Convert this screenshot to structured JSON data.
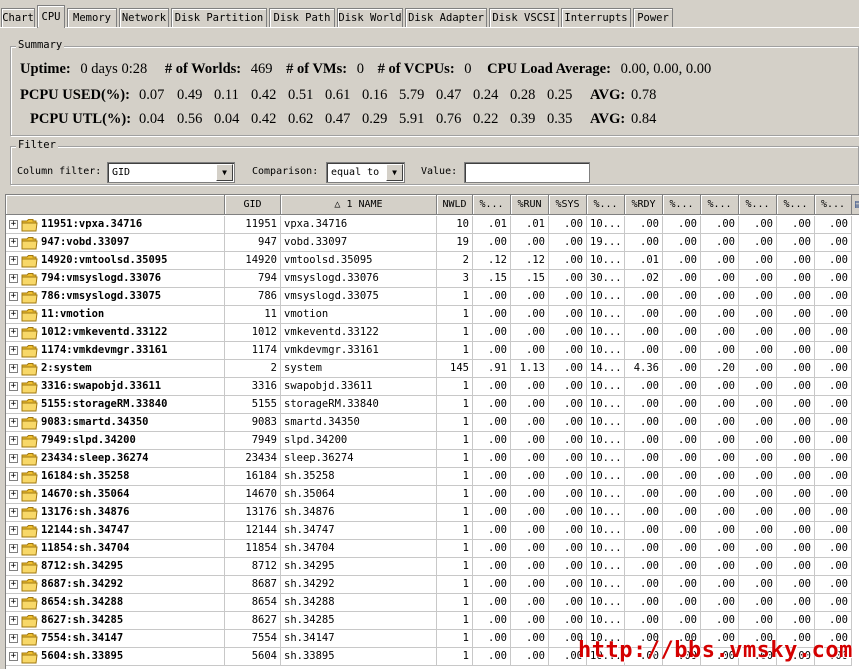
{
  "tabs": [
    "Chart",
    "CPU",
    "Memory",
    "Network",
    "Disk Partition",
    "Disk Path",
    "Disk World",
    "Disk Adapter",
    "Disk VSCSI",
    "Interrupts",
    "Power"
  ],
  "active_tab": "CPU",
  "summary": {
    "legend": "Summary",
    "uptime_label": "Uptime:",
    "uptime_value": "0 days 0:28",
    "worlds_label": "# of Worlds:",
    "worlds_value": "469",
    "vms_label": "# of VMs:",
    "vms_value": "0",
    "vcpus_label": "# of VCPUs:",
    "vcpus_value": "0",
    "load_label": "CPU Load Average:",
    "load_value": "0.00, 0.00, 0.00",
    "pcpu_used_label": "PCPU USED(%):",
    "pcpu_used": [
      "0.07",
      "0.49",
      "0.11",
      "0.42",
      "0.51",
      "0.61",
      "0.16",
      "5.79",
      "0.47",
      "0.24",
      "0.28",
      "0.25"
    ],
    "used_avg_label": "AVG:",
    "used_avg": "0.78",
    "pcpu_utl_label": "PCPU UTL(%):",
    "pcpu_utl": [
      "0.04",
      "0.56",
      "0.04",
      "0.42",
      "0.62",
      "0.47",
      "0.29",
      "5.91",
      "0.76",
      "0.22",
      "0.39",
      "0.35"
    ],
    "utl_avg_label": "AVG:",
    "utl_avg": "0.84"
  },
  "filter": {
    "legend": "Filter",
    "column_label": "Column filter:",
    "column_value": "GID",
    "comparison_label": "Comparison:",
    "comparison_value": "equal to",
    "value_label": "Value:",
    "value_text": ""
  },
  "table": {
    "headers": [
      "",
      "GID",
      "△ 1 NAME",
      "NWLD",
      "%...",
      "%RUN",
      "%SYS",
      "%...",
      "%RDY",
      "%...",
      "%...",
      "%...",
      "%...",
      "%..."
    ],
    "rows": [
      [
        "11951:vpxa.34716",
        "11951",
        "vpxa.34716",
        "10",
        ".01",
        ".01",
        ".00",
        "10...",
        ".00",
        ".00",
        ".00",
        ".00",
        ".00",
        ".00"
      ],
      [
        "947:vobd.33097",
        "947",
        "vobd.33097",
        "19",
        ".00",
        ".00",
        ".00",
        "19...",
        ".00",
        ".00",
        ".00",
        ".00",
        ".00",
        ".00"
      ],
      [
        "14920:vmtoolsd.35095",
        "14920",
        "vmtoolsd.35095",
        "2",
        ".12",
        ".12",
        ".00",
        "10...",
        ".01",
        ".00",
        ".00",
        ".00",
        ".00",
        ".00"
      ],
      [
        "794:vmsyslogd.33076",
        "794",
        "vmsyslogd.33076",
        "3",
        ".15",
        ".15",
        ".00",
        "30...",
        ".02",
        ".00",
        ".00",
        ".00",
        ".00",
        ".00"
      ],
      [
        "786:vmsyslogd.33075",
        "786",
        "vmsyslogd.33075",
        "1",
        ".00",
        ".00",
        ".00",
        "10...",
        ".00",
        ".00",
        ".00",
        ".00",
        ".00",
        ".00"
      ],
      [
        "11:vmotion",
        "11",
        "vmotion",
        "1",
        ".00",
        ".00",
        ".00",
        "10...",
        ".00",
        ".00",
        ".00",
        ".00",
        ".00",
        ".00"
      ],
      [
        "1012:vmkeventd.33122",
        "1012",
        "vmkeventd.33122",
        "1",
        ".00",
        ".00",
        ".00",
        "10...",
        ".00",
        ".00",
        ".00",
        ".00",
        ".00",
        ".00"
      ],
      [
        "1174:vmkdevmgr.33161",
        "1174",
        "vmkdevmgr.33161",
        "1",
        ".00",
        ".00",
        ".00",
        "10...",
        ".00",
        ".00",
        ".00",
        ".00",
        ".00",
        ".00"
      ],
      [
        "2:system",
        "2",
        "system",
        "145",
        ".91",
        "1.13",
        ".00",
        "14...",
        "4.36",
        ".00",
        ".20",
        ".00",
        ".00",
        ".00"
      ],
      [
        "3316:swapobjd.33611",
        "3316",
        "swapobjd.33611",
        "1",
        ".00",
        ".00",
        ".00",
        "10...",
        ".00",
        ".00",
        ".00",
        ".00",
        ".00",
        ".00"
      ],
      [
        "5155:storageRM.33840",
        "5155",
        "storageRM.33840",
        "1",
        ".00",
        ".00",
        ".00",
        "10...",
        ".00",
        ".00",
        ".00",
        ".00",
        ".00",
        ".00"
      ],
      [
        "9083:smartd.34350",
        "9083",
        "smartd.34350",
        "1",
        ".00",
        ".00",
        ".00",
        "10...",
        ".00",
        ".00",
        ".00",
        ".00",
        ".00",
        ".00"
      ],
      [
        "7949:slpd.34200",
        "7949",
        "slpd.34200",
        "1",
        ".00",
        ".00",
        ".00",
        "10...",
        ".00",
        ".00",
        ".00",
        ".00",
        ".00",
        ".00"
      ],
      [
        "23434:sleep.36274",
        "23434",
        "sleep.36274",
        "1",
        ".00",
        ".00",
        ".00",
        "10...",
        ".00",
        ".00",
        ".00",
        ".00",
        ".00",
        ".00"
      ],
      [
        "16184:sh.35258",
        "16184",
        "sh.35258",
        "1",
        ".00",
        ".00",
        ".00",
        "10...",
        ".00",
        ".00",
        ".00",
        ".00",
        ".00",
        ".00"
      ],
      [
        "14670:sh.35064",
        "14670",
        "sh.35064",
        "1",
        ".00",
        ".00",
        ".00",
        "10...",
        ".00",
        ".00",
        ".00",
        ".00",
        ".00",
        ".00"
      ],
      [
        "13176:sh.34876",
        "13176",
        "sh.34876",
        "1",
        ".00",
        ".00",
        ".00",
        "10...",
        ".00",
        ".00",
        ".00",
        ".00",
        ".00",
        ".00"
      ],
      [
        "12144:sh.34747",
        "12144",
        "sh.34747",
        "1",
        ".00",
        ".00",
        ".00",
        "10...",
        ".00",
        ".00",
        ".00",
        ".00",
        ".00",
        ".00"
      ],
      [
        "11854:sh.34704",
        "11854",
        "sh.34704",
        "1",
        ".00",
        ".00",
        ".00",
        "10...",
        ".00",
        ".00",
        ".00",
        ".00",
        ".00",
        ".00"
      ],
      [
        "8712:sh.34295",
        "8712",
        "sh.34295",
        "1",
        ".00",
        ".00",
        ".00",
        "10...",
        ".00",
        ".00",
        ".00",
        ".00",
        ".00",
        ".00"
      ],
      [
        "8687:sh.34292",
        "8687",
        "sh.34292",
        "1",
        ".00",
        ".00",
        ".00",
        "10...",
        ".00",
        ".00",
        ".00",
        ".00",
        ".00",
        ".00"
      ],
      [
        "8654:sh.34288",
        "8654",
        "sh.34288",
        "1",
        ".00",
        ".00",
        ".00",
        "10...",
        ".00",
        ".00",
        ".00",
        ".00",
        ".00",
        ".00"
      ],
      [
        "8627:sh.34285",
        "8627",
        "sh.34285",
        "1",
        ".00",
        ".00",
        ".00",
        "10...",
        ".00",
        ".00",
        ".00",
        ".00",
        ".00",
        ".00"
      ],
      [
        "7554:sh.34147",
        "7554",
        "sh.34147",
        "1",
        ".00",
        ".00",
        ".00",
        "10...",
        ".00",
        ".00",
        ".00",
        ".00",
        ".00",
        ".00"
      ],
      [
        "5604:sh.33895",
        "5604",
        "sh.33895",
        "1",
        ".00",
        ".00",
        ".00",
        "10...",
        ".00",
        ".00",
        ".00",
        ".00",
        ".00",
        ".00"
      ]
    ]
  },
  "watermark": "http://bbs.vmsky.com",
  "icons": {
    "folder": "folder-icon",
    "expander": "plus-expander-icon",
    "dropdown": "chevron-down-icon",
    "column_picker": "column-picker-icon"
  },
  "colors": {
    "watermark": "#d40000",
    "folder": "#f0c030"
  }
}
